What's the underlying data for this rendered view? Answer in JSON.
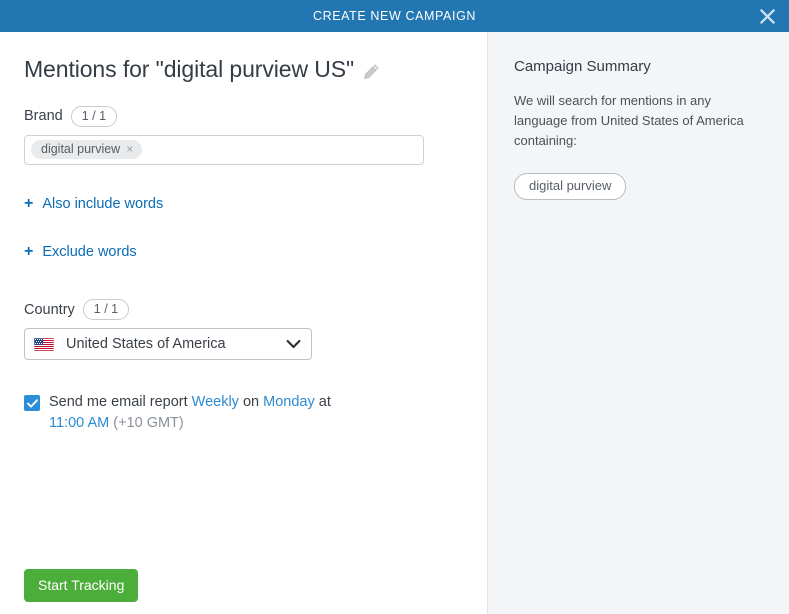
{
  "header": {
    "title": "CREATE NEW CAMPAIGN",
    "close_label": "×"
  },
  "left": {
    "page_title": "Mentions for \"digital purview US\"",
    "edit_icon": "pencil-icon",
    "brand": {
      "label": "Brand",
      "count": "1 / 1",
      "tags": [
        {
          "text": "digital purview",
          "remove": "×"
        }
      ],
      "placeholder": ""
    },
    "include_words": {
      "plus": "+",
      "label": "Also include words"
    },
    "exclude_words": {
      "plus": "+",
      "label": "Exclude words"
    },
    "country": {
      "label": "Country",
      "count": "1 / 1",
      "selected": "United States of America",
      "flag": "us-flag-icon",
      "options": [
        "United States of America"
      ]
    },
    "email_report": {
      "checked": true,
      "text_before": "Send me email report",
      "frequency": "Weekly",
      "text_on": "on",
      "day": "Monday",
      "text_at": "at",
      "time": "11:00 AM",
      "timezone": "(+10 GMT)"
    },
    "start_button": "Start Tracking"
  },
  "right": {
    "title": "Campaign Summary",
    "description": "We will search for mentions in any language from United States of America containing:",
    "chips": [
      {
        "text": "digital purview"
      }
    ]
  },
  "colors": {
    "header_blue": "#2276b2",
    "link_blue": "#0c6cb5",
    "accent_blue": "#2b8bd2",
    "primary_green": "#4cae3a",
    "panel_gray": "#f4f5f7"
  }
}
